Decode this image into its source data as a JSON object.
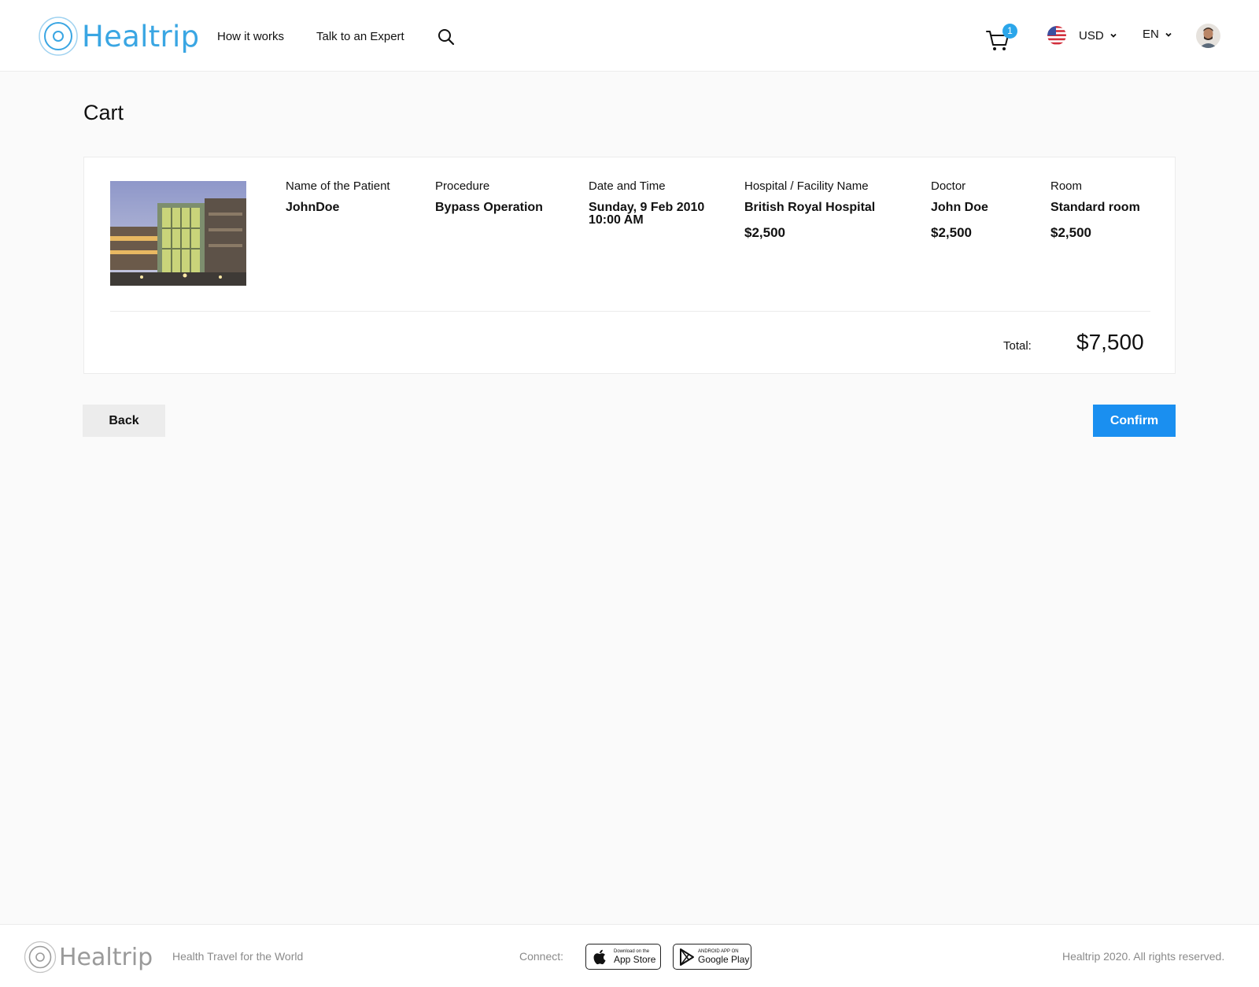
{
  "header": {
    "logo_text": "Healtrip",
    "nav": [
      {
        "label": "How it works"
      },
      {
        "label": "Talk to an Expert"
      }
    ],
    "cart_count": "1",
    "currency": "USD",
    "language": "EN"
  },
  "page": {
    "title": "Cart"
  },
  "cart_item": {
    "patient": {
      "label": "Name of the Patient",
      "value": "JohnDoe"
    },
    "procedure": {
      "label": "Procedure",
      "value": "Bypass Operation"
    },
    "datetime": {
      "label": "Date and Time",
      "date": "Sunday, 9 Feb 2010",
      "time": "10:00 AM"
    },
    "hospital": {
      "label": "Hospital / Facility Name",
      "value": "British Royal Hospital",
      "price": "$2,500"
    },
    "doctor": {
      "label": "Doctor",
      "value": "John Doe",
      "price": "$2,500"
    },
    "room": {
      "label": "Room",
      "value": "Standard room",
      "price": "$2,500"
    }
  },
  "total": {
    "label": "Total:",
    "value": "$7,500"
  },
  "actions": {
    "back_label": "Back",
    "confirm_label": "Confirm"
  },
  "footer": {
    "logo_text": "Healtrip",
    "tagline": "Health Travel for the World",
    "connect_label": "Connect:",
    "appstore_small": "Download on the",
    "appstore_big": "App Store",
    "gplay_small": "ANDROID APP ON",
    "gplay_big": "Google Play",
    "copyright": "Healtrip 2020. All rights reserved."
  },
  "colors": {
    "brand": "#3aa6e3",
    "confirm": "#1a8ff0",
    "badge": "#2ba6ea"
  }
}
